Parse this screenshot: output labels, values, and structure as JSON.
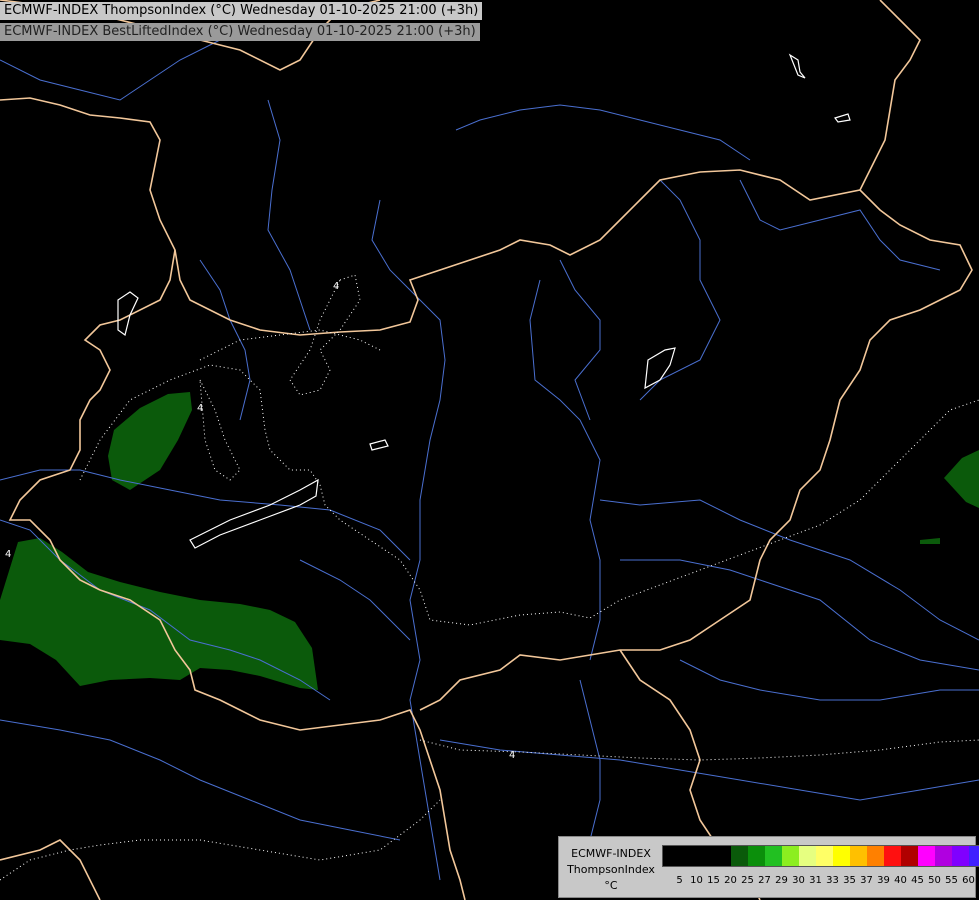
{
  "header": {
    "line1": "ECMWF-INDEX ThompsonIndex (°C) Wednesday 01-10-2025 21:00 (+3h)",
    "line2": "ECMWF-INDEX BestLiftedIndex (°C) Wednesday 01-10-2025 21:00 (+3h)"
  },
  "map": {
    "contour_labels": [
      "4",
      "4",
      "4",
      "4"
    ],
    "colors": {
      "background": "#000000",
      "border": "#f2c79a",
      "river": "#4a6fd0",
      "shaded_area": "#0b5a0b",
      "dotted_contour": "#ffffff"
    }
  },
  "legend": {
    "line1": "ECMWF-INDEX",
    "line2": "ThompsonIndex",
    "line3": "°C",
    "swatch_colors": [
      "#000000",
      "#000000",
      "#000000",
      "#000000",
      "#0a5a0a",
      "#0b8f0b",
      "#22c022",
      "#8cee20",
      "#e6ff80",
      "#ffff66",
      "#ffff00",
      "#ffc000",
      "#ff8000",
      "#ff1010",
      "#b00000",
      "#ff00ff",
      "#b000e0",
      "#8000ff",
      "#4020ff",
      "#0010ff"
    ],
    "ticks": [
      "5",
      "10",
      "15",
      "20",
      "25",
      "27",
      "29",
      "30",
      "31",
      "33",
      "35",
      "37",
      "39",
      "40",
      "45",
      "50",
      "55",
      "60"
    ]
  }
}
